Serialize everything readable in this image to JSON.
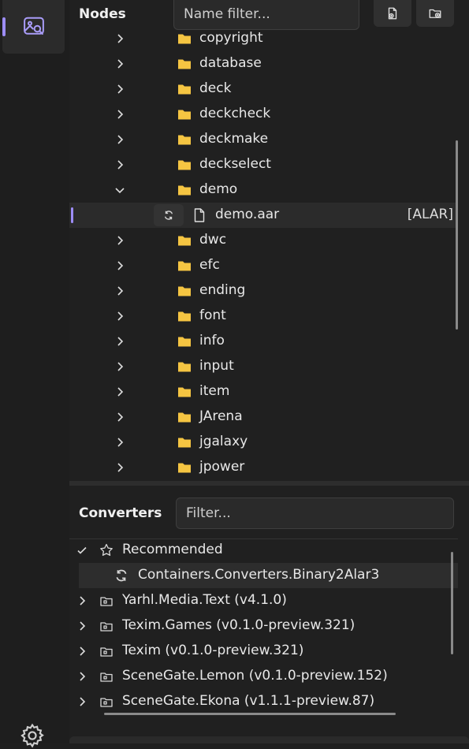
{
  "nodes": {
    "title": "Nodes",
    "filter_placeholder": "Name filter...",
    "tree": [
      {
        "label": "copyright",
        "type": "folder",
        "expanded": false
      },
      {
        "label": "database",
        "type": "folder",
        "expanded": false
      },
      {
        "label": "deck",
        "type": "folder",
        "expanded": false
      },
      {
        "label": "deckcheck",
        "type": "folder",
        "expanded": false
      },
      {
        "label": "deckmake",
        "type": "folder",
        "expanded": false
      },
      {
        "label": "deckselect",
        "type": "folder",
        "expanded": false
      },
      {
        "label": "demo",
        "type": "folder",
        "expanded": true
      },
      {
        "label": "demo.aar",
        "type": "file",
        "tag": "[ALAR]",
        "selected": true
      },
      {
        "label": "dwc",
        "type": "folder",
        "expanded": false
      },
      {
        "label": "efc",
        "type": "folder",
        "expanded": false
      },
      {
        "label": "ending",
        "type": "folder",
        "expanded": false
      },
      {
        "label": "font",
        "type": "folder",
        "expanded": false
      },
      {
        "label": "info",
        "type": "folder",
        "expanded": false
      },
      {
        "label": "input",
        "type": "folder",
        "expanded": false
      },
      {
        "label": "item",
        "type": "folder",
        "expanded": false
      },
      {
        "label": "JArena",
        "type": "folder",
        "expanded": false
      },
      {
        "label": "jgalaxy",
        "type": "folder",
        "expanded": false
      },
      {
        "label": "jpower",
        "type": "folder",
        "expanded": false
      }
    ]
  },
  "converters": {
    "title": "Converters",
    "filter_placeholder": "Filter...",
    "items": [
      {
        "label": "Recommended",
        "icon": "star-outline-icon",
        "expanded": true
      },
      {
        "label": "Containers.Converters.Binary2Alar3",
        "icon": "sync-icon",
        "child": true,
        "selected": true
      },
      {
        "label": "Yarhl.Media.Text (v4.1.0)",
        "icon": "package-icon",
        "expanded": false
      },
      {
        "label": "Texim.Games (v0.1.0-preview.321)",
        "icon": "package-icon",
        "expanded": false
      },
      {
        "label": "Texim (v0.1.0-preview.321)",
        "icon": "package-icon",
        "expanded": false
      },
      {
        "label": "SceneGate.Lemon (v0.1.0-preview.152)",
        "icon": "package-icon",
        "expanded": false
      },
      {
        "label": "SceneGate.Ekona (v1.1.1-preview.87)",
        "icon": "package-icon",
        "expanded": false
      }
    ]
  },
  "colors": {
    "accent": "#9d8df7",
    "folder": "#f5c542"
  }
}
